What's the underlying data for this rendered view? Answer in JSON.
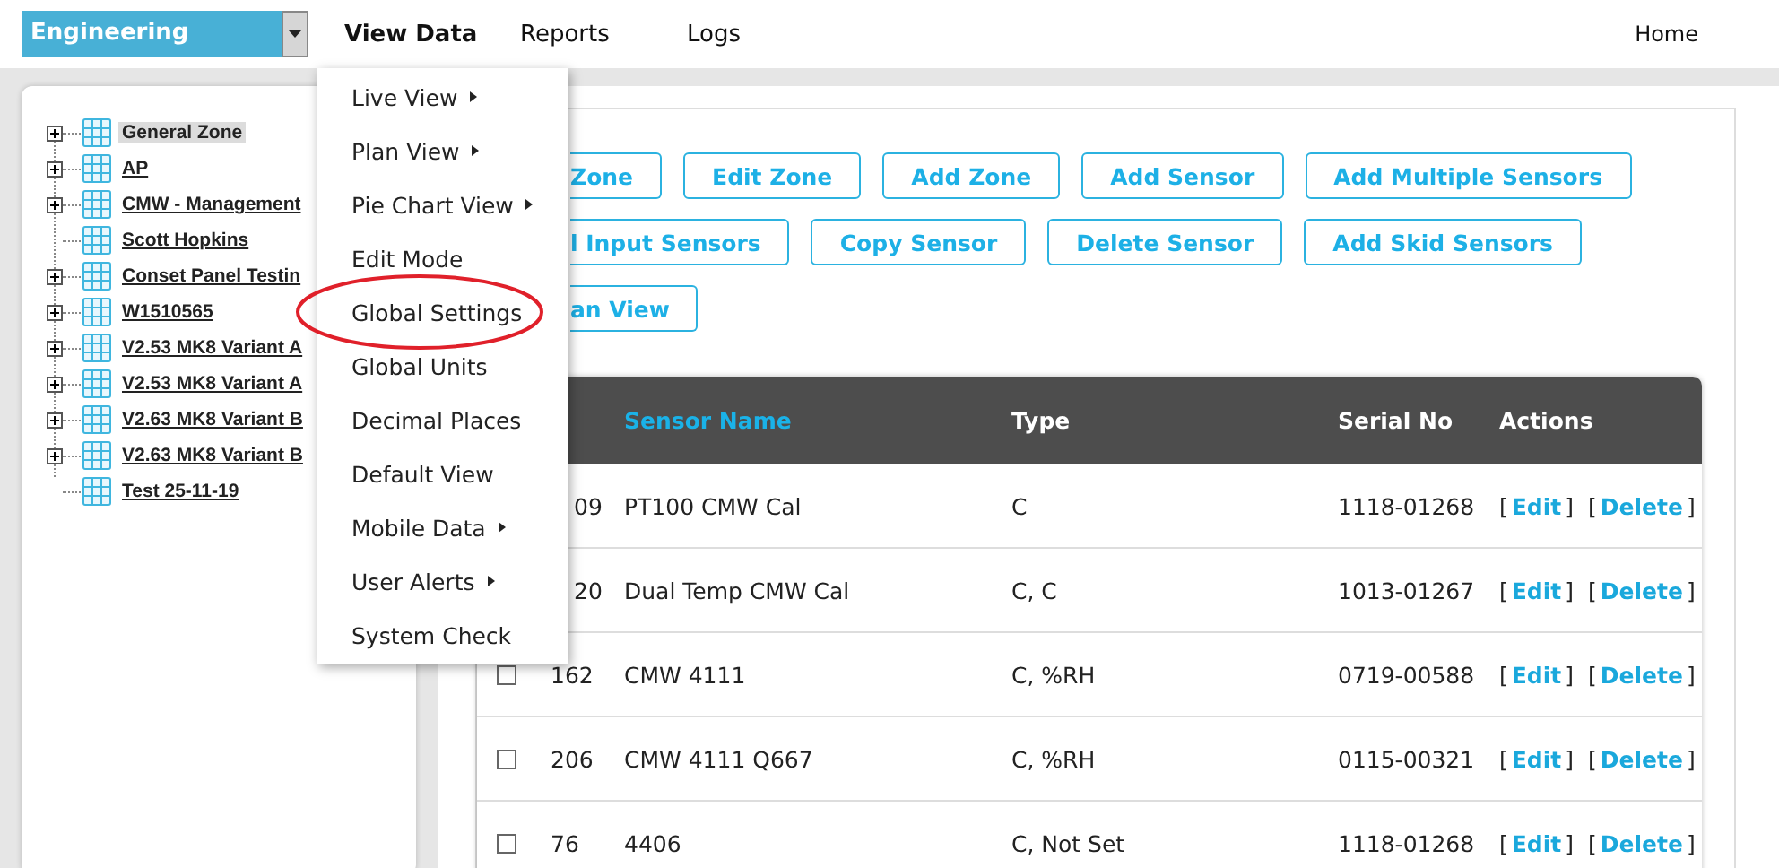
{
  "zone_select": {
    "value": "Engineering"
  },
  "nav": [
    {
      "label": "View Data",
      "selected": true
    },
    {
      "label": "Reports",
      "selected": false
    },
    {
      "label": "Logs",
      "selected": false
    }
  ],
  "home_link": "Home",
  "tree": [
    {
      "label": "General Zone",
      "selected": true,
      "expanded": false
    },
    {
      "label": "AP",
      "selected": false,
      "expanded": false
    },
    {
      "label": "CMW - Management",
      "selected": false,
      "expanded": false
    },
    {
      "label": "Scott Hopkins",
      "selected": false
    },
    {
      "label": "Conset Panel Testin",
      "selected": false,
      "expanded": false
    },
    {
      "label": "W1510565",
      "selected": false,
      "expanded": false
    },
    {
      "label": "V2.53 MK8 Variant A",
      "selected": false,
      "expanded": false
    },
    {
      "label": "V2.53 MK8 Variant A",
      "selected": false,
      "expanded": false
    },
    {
      "label": "V2.63 MK8 Variant B",
      "selected": false,
      "expanded": false
    },
    {
      "label": "V2.63 MK8 Variant B",
      "selected": false,
      "expanded": false
    },
    {
      "label": "Test 25-11-19",
      "selected": false
    }
  ],
  "menu": [
    {
      "label": "Live View",
      "submenu": true,
      "circled": false
    },
    {
      "label": "Plan View",
      "submenu": true,
      "circled": false
    },
    {
      "label": "Pie Chart View",
      "submenu": true,
      "circled": false
    },
    {
      "label": "Edit Mode",
      "submenu": false,
      "circled": false
    },
    {
      "label": "Global Settings",
      "submenu": false,
      "circled": true
    },
    {
      "label": "Global Units",
      "submenu": false,
      "circled": false
    },
    {
      "label": "Decimal Places",
      "submenu": false,
      "circled": false
    },
    {
      "label": "Default View",
      "submenu": false,
      "circled": false
    },
    {
      "label": "Mobile Data",
      "submenu": true,
      "circled": false
    },
    {
      "label": "User Alerts",
      "submenu": true,
      "circled": false
    },
    {
      "label": "System Check",
      "submenu": false,
      "circled": false
    }
  ],
  "button_rows": [
    [
      "Zone",
      "Edit Zone",
      "Add Zone",
      "Add Sensor",
      "Add Multiple Sensors"
    ],
    [
      "l Input Sensors",
      "Copy Sensor",
      "Delete Sensor",
      "Add Skid Sensors"
    ],
    [
      "an View"
    ]
  ],
  "table": {
    "columns": [
      {
        "label": "Sensor Name",
        "sorted": true
      },
      {
        "label": "Type",
        "sorted": false
      },
      {
        "label": "Serial No",
        "sorted": false
      },
      {
        "label": "Actions",
        "sorted": false
      }
    ],
    "rows": [
      {
        "id": "09",
        "name": "PT100 CMW Cal",
        "type": "C",
        "serial": "1118-01268",
        "actions": [
          {
            "open": "[",
            "label": "Edit",
            "close": "]"
          },
          {
            "open": "[",
            "label": "Delete",
            "close": "]"
          }
        ]
      },
      {
        "id": "20",
        "name": "Dual Temp CMW Cal",
        "type": "C, C",
        "serial": "1013-01267",
        "actions": [
          {
            "open": "[",
            "label": "Edit",
            "close": "]"
          },
          {
            "open": "[",
            "label": "Delete",
            "close": "]"
          }
        ]
      },
      {
        "checked": false,
        "id": "162",
        "name": "CMW 4111",
        "type": "C, %RH",
        "serial": "0719-00588",
        "actions": [
          {
            "open": "[",
            "label": "Edit",
            "close": "]"
          },
          {
            "open": "[",
            "label": "Delete",
            "close": "]"
          }
        ]
      },
      {
        "checked": false,
        "id": "206",
        "name": "CMW 4111 Q667",
        "type": "C, %RH",
        "serial": "0115-00321",
        "actions": [
          {
            "open": "[",
            "label": "Edit",
            "close": "]"
          },
          {
            "open": "[",
            "label": "Delete",
            "close": "]"
          }
        ]
      },
      {
        "checked": false,
        "id": "76",
        "name": "4406",
        "type": "C, Not Set",
        "serial": "1118-01268",
        "actions": [
          {
            "open": "[",
            "label": "Edit",
            "close": "]"
          },
          {
            "open": "[",
            "label": "Delete",
            "close": "]"
          }
        ]
      }
    ]
  }
}
